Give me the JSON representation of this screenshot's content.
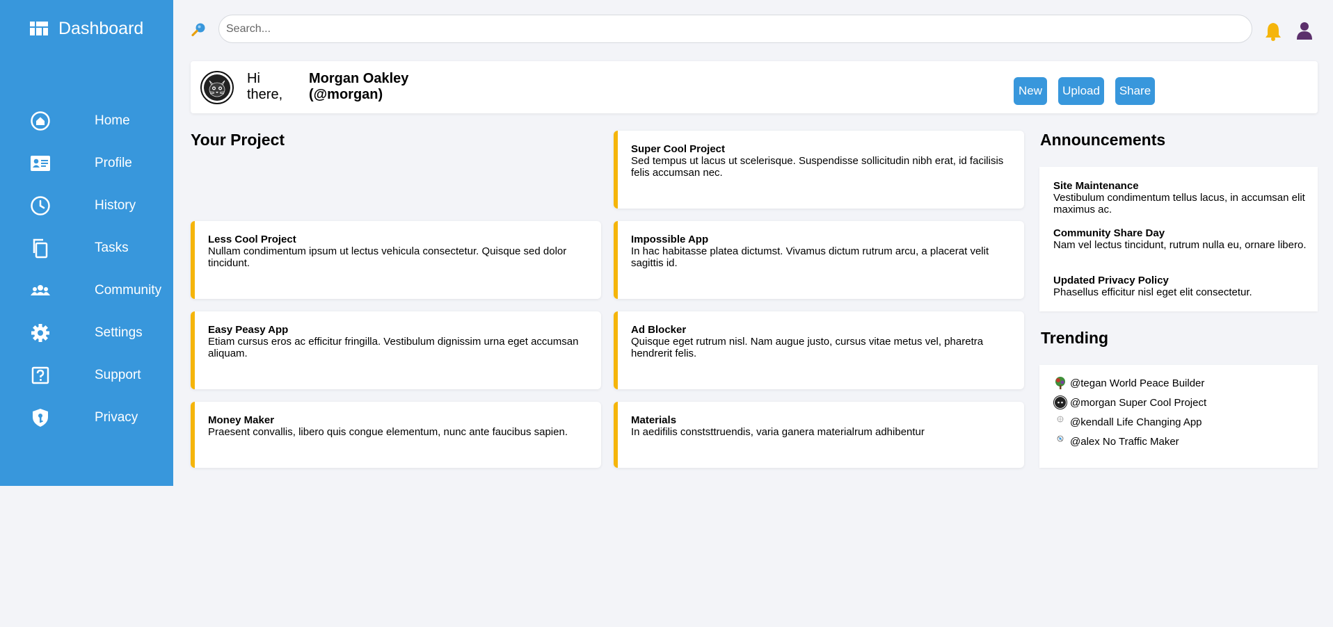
{
  "app": {
    "title": "Dashboard"
  },
  "sidebar": {
    "items": [
      {
        "label": "Home",
        "icon": "home-icon"
      },
      {
        "label": "Profile",
        "icon": "id-card-icon"
      },
      {
        "label": "History",
        "icon": "clock-icon"
      },
      {
        "label": "Tasks",
        "icon": "copy-icon"
      },
      {
        "label": "Community",
        "icon": "users-icon"
      },
      {
        "label": "Settings",
        "icon": "gear-icon"
      },
      {
        "label": "Support",
        "icon": "question-icon"
      },
      {
        "label": "Privacy",
        "icon": "shield-key-icon"
      }
    ]
  },
  "search": {
    "placeholder": "Search..."
  },
  "greeting": {
    "hi": "Hi there,",
    "name": "Morgan Oakley (@morgan)",
    "buttons": {
      "new": "New",
      "upload": "Upload",
      "share": "Share"
    }
  },
  "projects": {
    "title": "Your Project",
    "items": [
      {
        "title": "Super Cool Project",
        "desc": "Sed tempus ut lacus ut scelerisque. Suspendisse sollicitudin nibh erat, id facilisis felis accumsan nec."
      },
      {
        "title": "Less Cool Project",
        "desc": "Nullam condimentum ipsum ut lectus vehicula consectetur. Quisque sed dolor tincidunt."
      },
      {
        "title": "Impossible App",
        "desc": "In hac habitasse platea dictumst. Vivamus dictum rutrum arcu, a placerat velit sagittis id."
      },
      {
        "title": "Easy Peasy App",
        "desc": "Etiam cursus eros ac efficitur fringilla. Vestibulum dignissim urna eget accumsan aliquam."
      },
      {
        "title": "Ad Blocker",
        "desc": "Quisque eget rutrum nisl. Nam augue justo, cursus vitae metus vel, pharetra hendrerit felis."
      },
      {
        "title": "Money Maker",
        "desc": "Praesent convallis, libero quis congue elementum, nunc ante faucibus sapien."
      },
      {
        "title": "Materials",
        "desc": "In aedifilis conststtruendis, varia ganera materialrum adhibentur"
      }
    ]
  },
  "announcements": {
    "title": "Announcements",
    "items": [
      {
        "title": "Site Maintenance",
        "text": "Vestibulum condimentum tellus lacus, in accumsan elit maximus ac."
      },
      {
        "title": "Community Share Day",
        "text": "Nam vel lectus tincidunt, rutrum nulla eu, ornare libero."
      },
      {
        "title": "Updated Privacy Policy",
        "text": "Phasellus efficitur nisl eget elit consectetur."
      }
    ]
  },
  "trending": {
    "title": "Trending",
    "items": [
      {
        "text": "@tegan World Peace Builder"
      },
      {
        "text": "@morgan Super Cool Project"
      },
      {
        "text": "@kendall Life Changing App"
      },
      {
        "text": "@alex No Traffic Maker"
      }
    ]
  },
  "colors": {
    "sidebar": "#3897dc",
    "accent": "#f5b50b",
    "button": "#3897dc",
    "background": "#f3f4f8"
  }
}
